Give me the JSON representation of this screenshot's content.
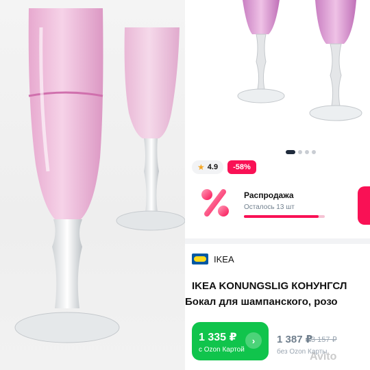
{
  "rating": {
    "value": "4.9",
    "star_icon": "star-icon"
  },
  "discount": {
    "label": "-58%"
  },
  "sale": {
    "title": "Распродажа",
    "remaining": "Осталось 13 шт",
    "progress_fraction": 0.92,
    "icon": "percent-icon"
  },
  "gallery": {
    "dots": [
      true,
      false,
      false,
      false
    ]
  },
  "brand": {
    "name": "IKEA",
    "logo": "ikea-logo"
  },
  "product": {
    "title": "IKEA KONUNGSLIG КОНУНГСЛ",
    "subtitle": "Бокал для шампанского, розо"
  },
  "price": {
    "card_price": "1 335 ₽",
    "card_note": "с Ozon Картой",
    "regular_price": "1 387 ₽",
    "old_price": "3 157 ₽",
    "regular_note": "без Ozon Карты"
  },
  "watermark": "Avito",
  "colors": {
    "accent": "#f91155",
    "green": "#10c44c",
    "text": "#111111",
    "muted": "#707f8d"
  }
}
